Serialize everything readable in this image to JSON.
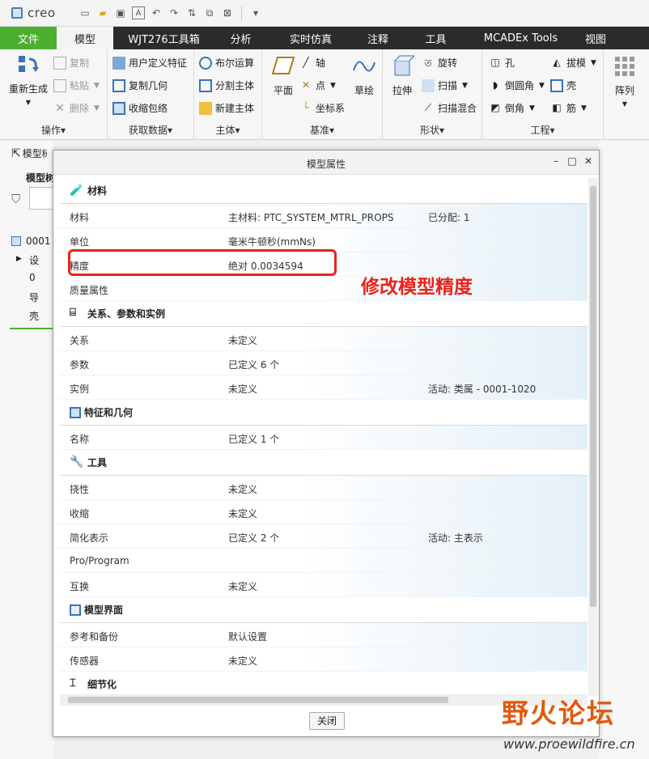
{
  "app": {
    "logo_text": "creo"
  },
  "menu": {
    "tabs": [
      "文件",
      "模型",
      "WJT276工具箱",
      "分析",
      "实时仿真",
      "注释",
      "工具",
      "MCADEx Tools",
      "视图"
    ]
  },
  "ribbon": {
    "groups": {
      "operations": {
        "label": "操作",
        "regen": "重新生成",
        "copy": "复制",
        "paste": "粘贴",
        "delete": "删除"
      },
      "getdata": {
        "label": "获取数据",
        "udf": "用户定义特征",
        "copy_geom": "复制几何",
        "shrinkwrap": "收缩包络"
      },
      "body": {
        "label": "主体",
        "boolean": "布尔运算",
        "split": "分割主体",
        "new_body": "新建主体"
      },
      "datum": {
        "label": "基准",
        "plane": "平面",
        "axis": "轴",
        "point": "点",
        "csys": "坐标系",
        "sketch": "草绘"
      },
      "shape": {
        "label": "形状",
        "extrude": "拉伸",
        "revolve": "旋转",
        "sweep": "扫描",
        "swept_blend": "扫描混合"
      },
      "engineering": {
        "label": "工程",
        "hole": "孔",
        "round": "倒圆角",
        "chamfer": "倒角",
        "draft": "拔模",
        "shell": "壳",
        "rib": "筋"
      },
      "pattern": {
        "label": "阵列"
      }
    }
  },
  "left": {
    "tree_label": "模型树",
    "tree_filter": "模型树",
    "root": "0001",
    "items": [
      "设",
      "0",
      "导",
      "壳"
    ]
  },
  "dialog": {
    "title": "模型属性",
    "close_label": "关闭",
    "sections": {
      "material": {
        "title": "材料",
        "rows": [
          {
            "name": "材料",
            "value": "主材料: PTC_SYSTEM_MTRL_PROPS",
            "extra": "已分配: 1"
          },
          {
            "name": "单位",
            "value": "毫米牛顿秒(mmNs)",
            "extra": ""
          },
          {
            "name": "精度",
            "value": "绝对 0.0034594",
            "extra": ""
          },
          {
            "name": "质量属性",
            "value": "",
            "extra": ""
          }
        ]
      },
      "relations": {
        "title": "关系、参数和实例",
        "rows": [
          {
            "name": "关系",
            "value": "未定义",
            "extra": ""
          },
          {
            "name": "参数",
            "value": "已定义 6 个",
            "extra": ""
          },
          {
            "name": "实例",
            "value": "未定义",
            "extra": "活动: 类属 - 0001-1020"
          }
        ]
      },
      "features": {
        "title": "特征和几何",
        "rows": [
          {
            "name": "名称",
            "value": "已定义 1 个",
            "extra": ""
          }
        ]
      },
      "tools": {
        "title": "工具",
        "rows": [
          {
            "name": "挠性",
            "value": "未定义",
            "extra": ""
          },
          {
            "name": "收缩",
            "value": "未定义",
            "extra": ""
          },
          {
            "name": "简化表示",
            "value": "已定义 2 个",
            "extra": "活动: 主表示"
          },
          {
            "name": "Pro/Program",
            "value": "",
            "extra": ""
          },
          {
            "name": "互换",
            "value": "未定义",
            "extra": ""
          }
        ]
      },
      "interface": {
        "title": "模型界面",
        "rows": [
          {
            "name": "参考和备份",
            "value": "默认设置",
            "extra": ""
          },
          {
            "name": "传感器",
            "value": "未定义",
            "extra": ""
          }
        ]
      },
      "detail": {
        "title": "细节化"
      }
    }
  },
  "annotation": {
    "text": "修改模型精度",
    "color": "#e8241a"
  },
  "watermark": {
    "text": "野火论坛",
    "url": "www.proewildfire.cn"
  }
}
